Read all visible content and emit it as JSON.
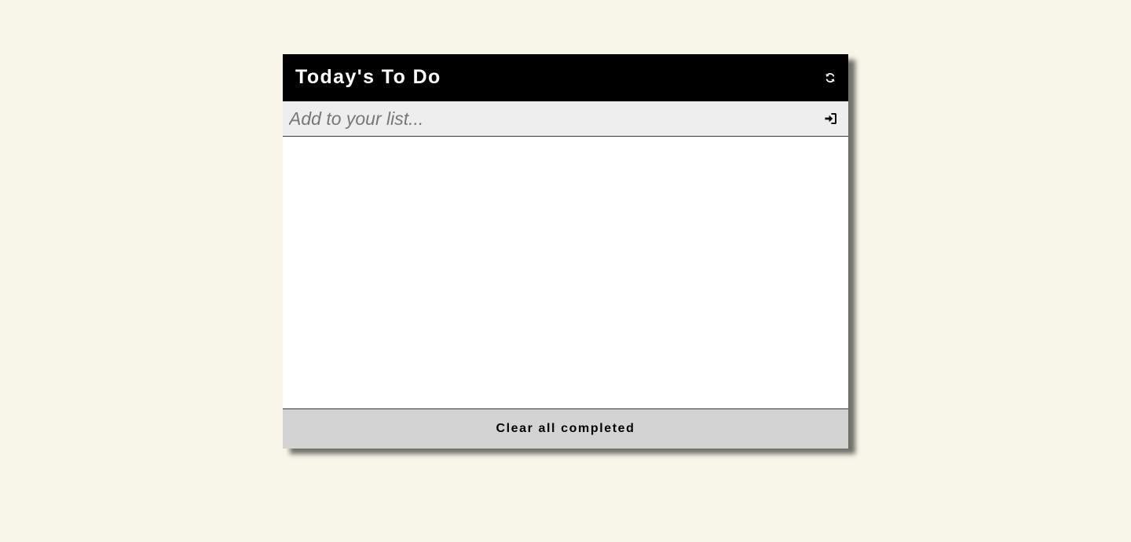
{
  "app": {
    "title": "Today's To Do"
  },
  "header": {
    "refresh_icon": "refresh-icon"
  },
  "add": {
    "placeholder": "Add to your list...",
    "value": "",
    "submit_icon": "sign-in-icon"
  },
  "list": {
    "items": []
  },
  "footer": {
    "clear_label": "Clear all completed"
  },
  "colors": {
    "page_background": "#f8f6e9",
    "header_background": "#000000",
    "header_text": "#ffffff",
    "input_background": "#eeeeee",
    "footer_background": "#d3d3d3"
  }
}
